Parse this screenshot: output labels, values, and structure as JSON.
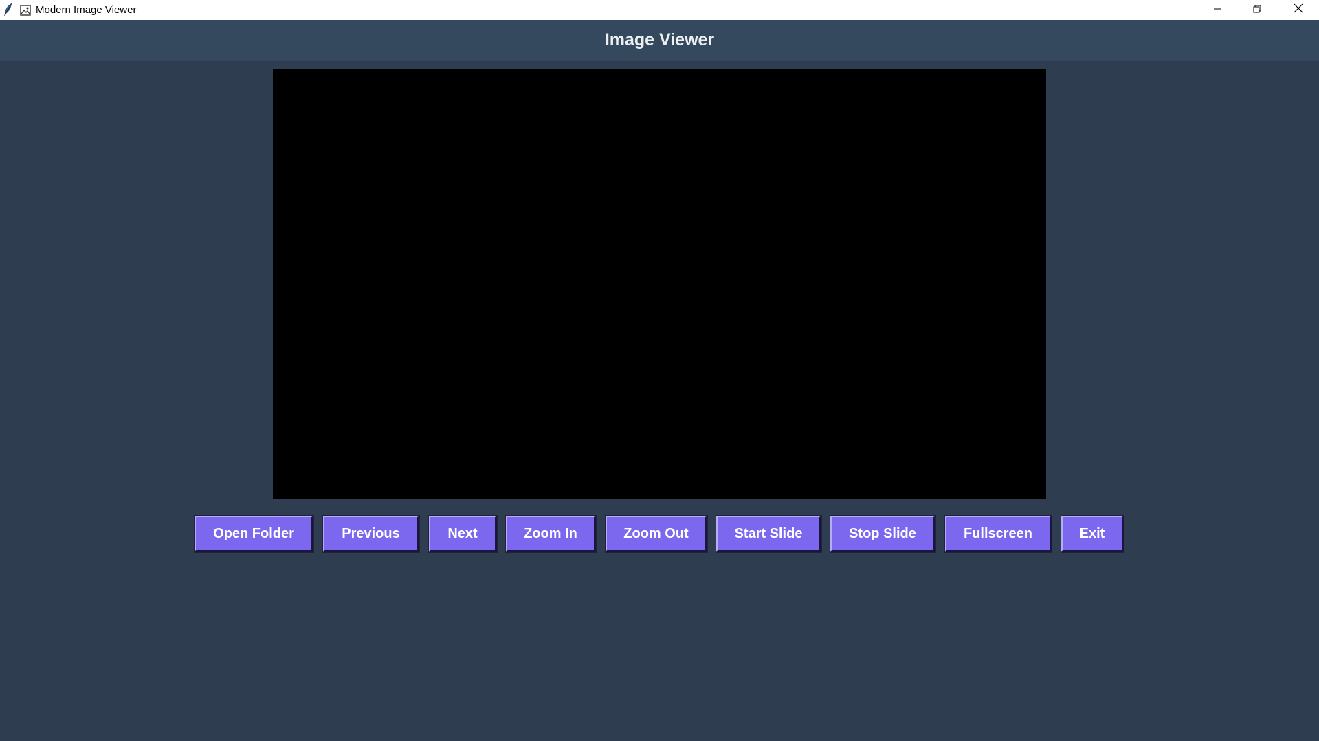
{
  "window": {
    "title": "Modern Image Viewer",
    "icons": [
      "tk-feather-icon",
      "image-icon",
      "minimize-icon",
      "maximize-icon",
      "close-icon"
    ]
  },
  "header": {
    "title": "Image Viewer"
  },
  "toolbar": {
    "open_folder": "Open Folder",
    "previous": "Previous",
    "next": "Next",
    "zoom_in": "Zoom In",
    "zoom_out": "Zoom Out",
    "start_slide": "Start Slide",
    "stop_slide": "Stop Slide",
    "fullscreen": "Fullscreen",
    "exit": "Exit"
  },
  "colors": {
    "background": "#2e3e50",
    "header": "#35495e",
    "canvas": "#000000",
    "button": "#7b68ee",
    "button_text": "#ffffff",
    "header_text": "#ecf0f1"
  }
}
